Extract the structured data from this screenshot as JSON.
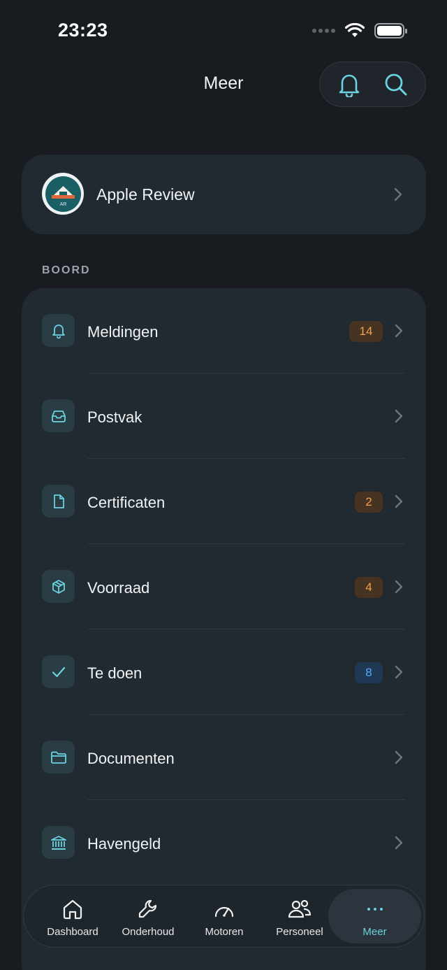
{
  "status_bar": {
    "time": "23:23"
  },
  "header": {
    "title": "Meer",
    "notifications_icon": "bell-icon",
    "search_icon": "search-icon"
  },
  "profile": {
    "name": "Apple Review",
    "avatar_initials": "AR"
  },
  "section": {
    "label": "BOORD",
    "items": [
      {
        "label": "Meldingen",
        "icon": "bell-icon",
        "badge": "14",
        "badge_color": "orange"
      },
      {
        "label": "Postvak",
        "icon": "inbox-icon",
        "badge": "",
        "badge_color": ""
      },
      {
        "label": "Certificaten",
        "icon": "document-icon",
        "badge": "2",
        "badge_color": "orange"
      },
      {
        "label": "Voorraad",
        "icon": "box-icon",
        "badge": "4",
        "badge_color": "orange"
      },
      {
        "label": "Te doen",
        "icon": "checkmark-icon",
        "badge": "8",
        "badge_color": "blue"
      },
      {
        "label": "Documenten",
        "icon": "folder-icon",
        "badge": "",
        "badge_color": ""
      },
      {
        "label": "Havengeld",
        "icon": "bank-icon",
        "badge": "",
        "badge_color": ""
      }
    ]
  },
  "tab_bar": {
    "tabs": [
      {
        "label": "Dashboard",
        "icon": "home-icon"
      },
      {
        "label": "Onderhoud",
        "icon": "wrench-icon"
      },
      {
        "label": "Motoren",
        "icon": "gauge-icon"
      },
      {
        "label": "Personeel",
        "icon": "people-icon"
      },
      {
        "label": "Meer",
        "icon": "more-icon",
        "active": true
      }
    ]
  },
  "colors": {
    "background": "#181c21",
    "card": "#212a31",
    "accent": "#6ad2e0",
    "badge_orange": "#f2a24c",
    "badge_blue": "#5aa7ff"
  }
}
